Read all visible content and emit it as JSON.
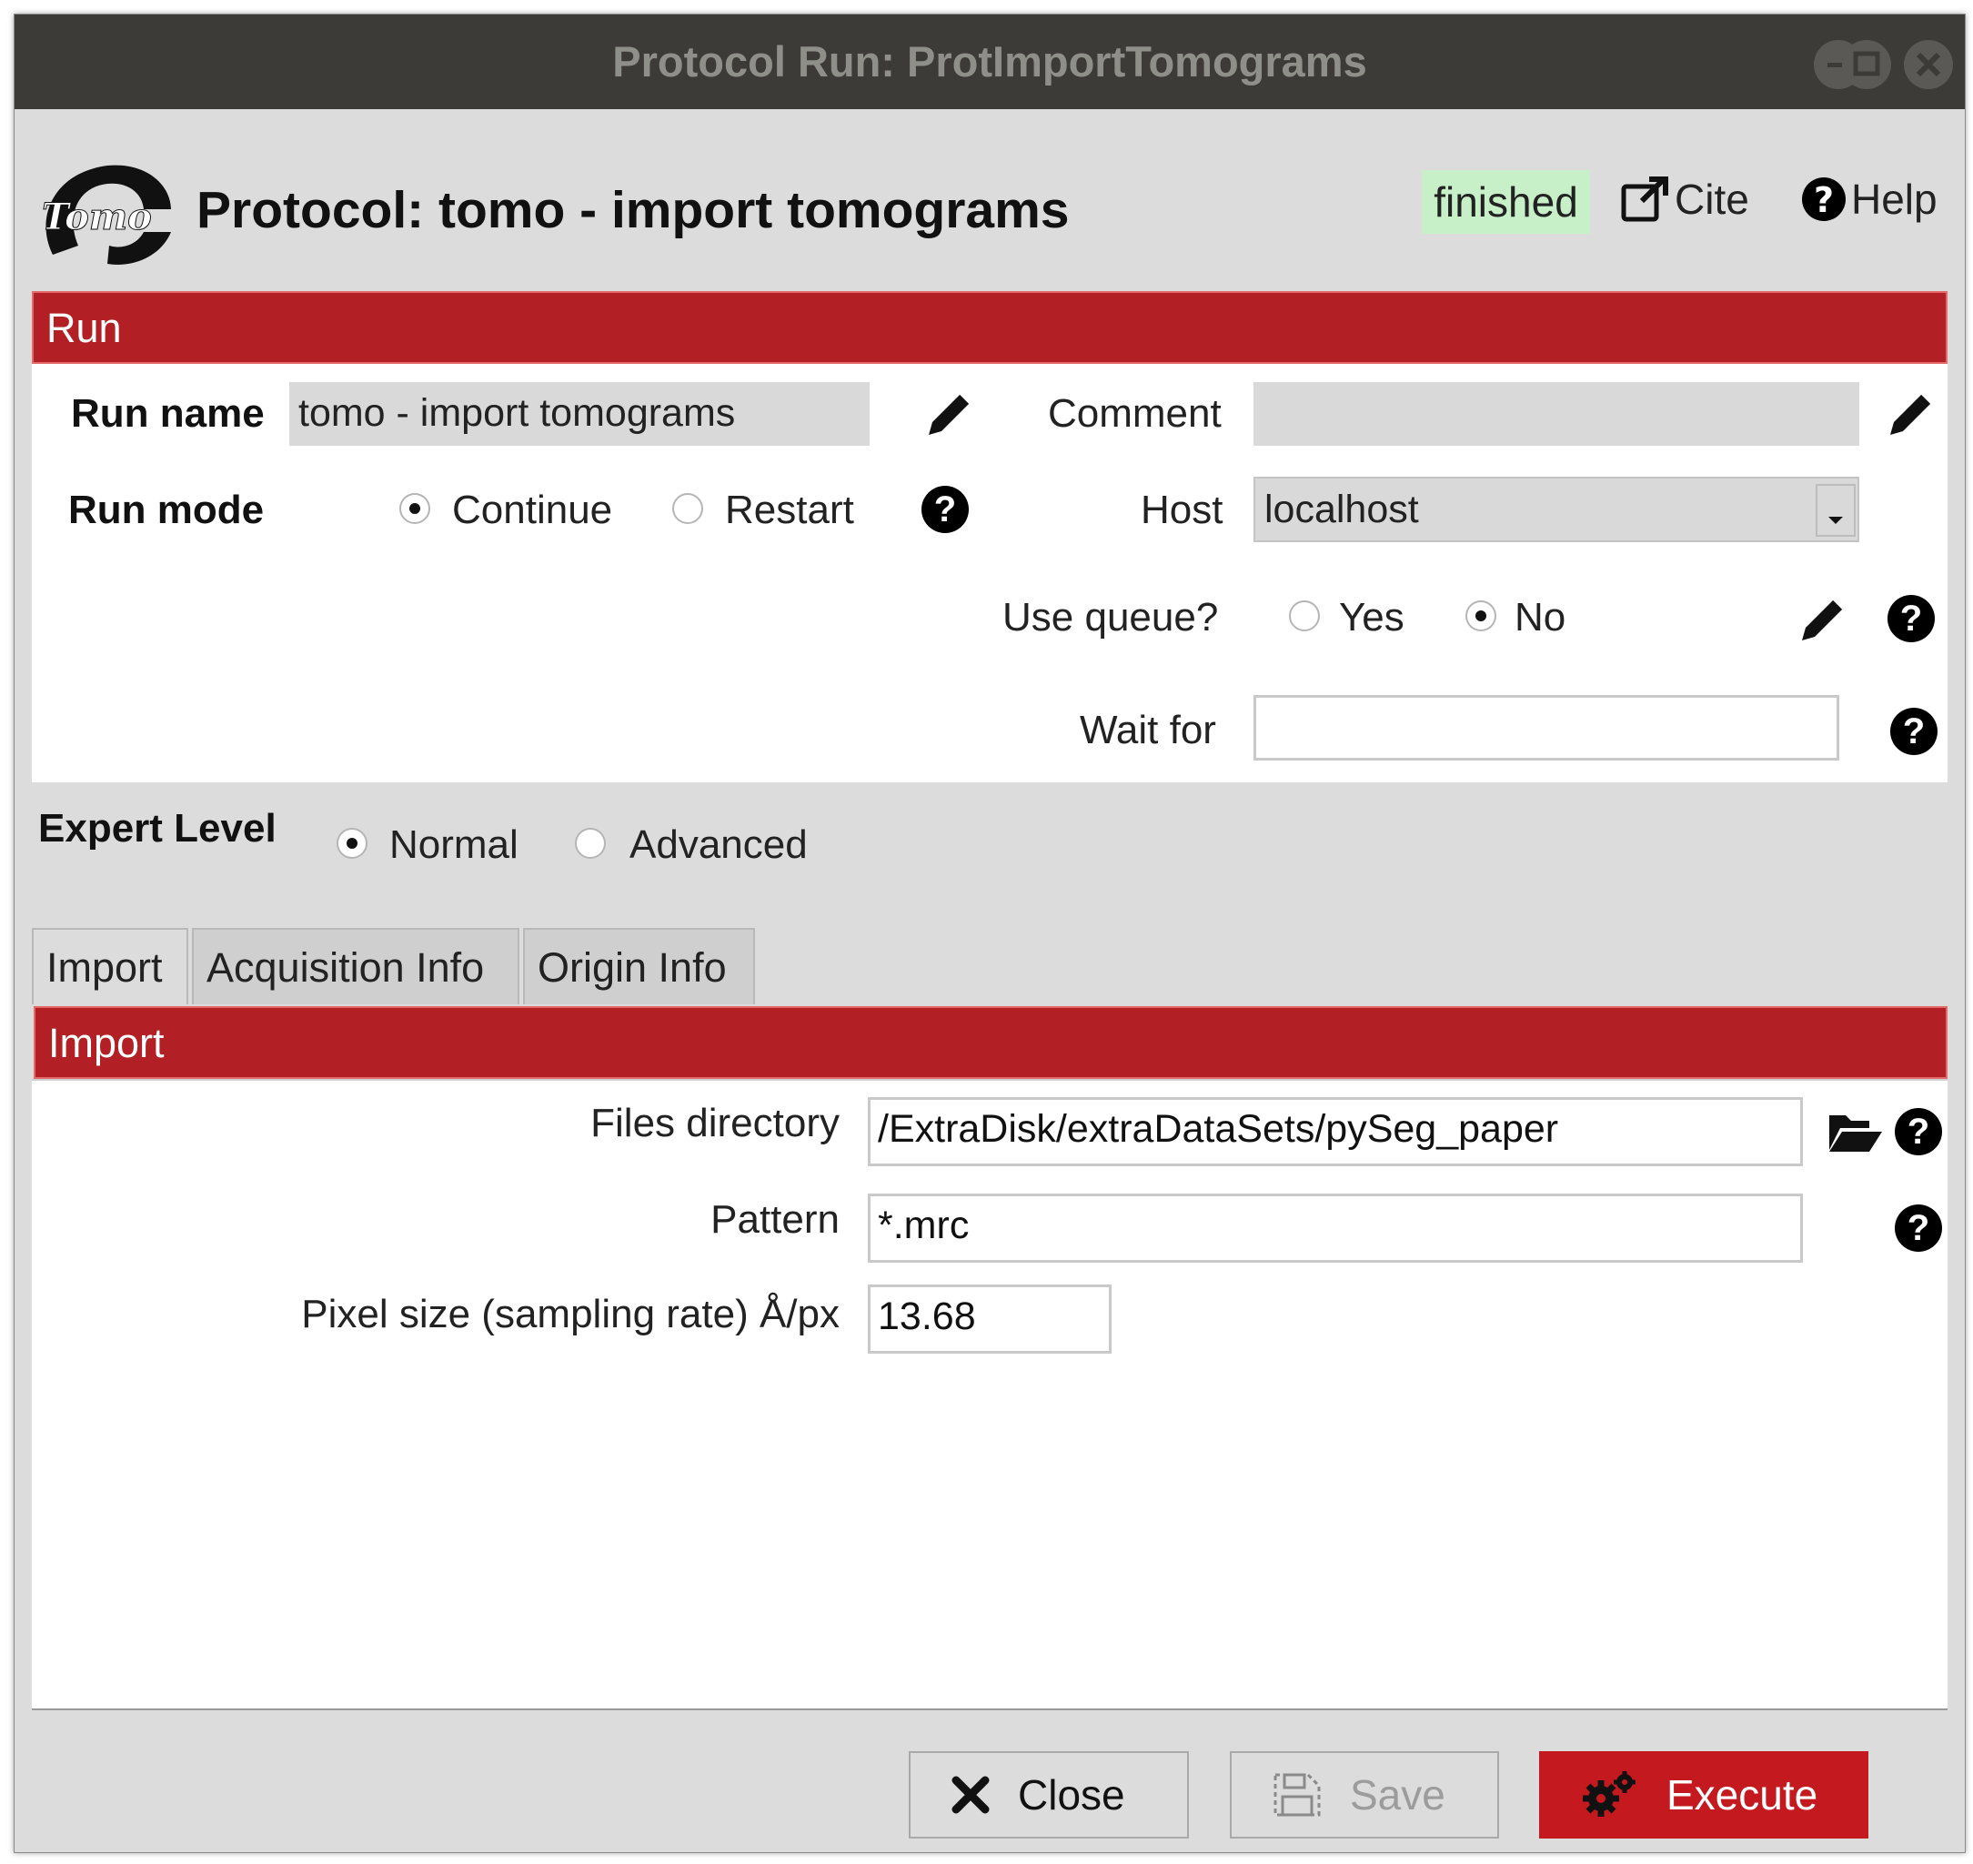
{
  "window": {
    "title": "Protocol Run: ProtImportTomograms"
  },
  "header": {
    "logo_text": "Tomo",
    "protocol_title": "Protocol: tomo - import tomograms",
    "status": "finished",
    "cite_label": "Cite",
    "help_label": "Help"
  },
  "run_section": {
    "title": "Run",
    "run_name_label": "Run name",
    "run_name_value": "tomo - import tomograms",
    "comment_label": "Comment",
    "comment_value": "",
    "run_mode_label": "Run mode",
    "run_mode_options": [
      "Continue",
      "Restart"
    ],
    "run_mode_selected": "Continue",
    "host_label": "Host",
    "host_value": "localhost",
    "use_queue_label": "Use queue?",
    "use_queue_options": [
      "Yes",
      "No"
    ],
    "use_queue_selected": "No",
    "wait_for_label": "Wait for",
    "wait_for_value": ""
  },
  "expert_level": {
    "label": "Expert Level",
    "options": [
      "Normal",
      "Advanced"
    ],
    "selected": "Normal"
  },
  "tabs": [
    {
      "label": "Import",
      "active": true
    },
    {
      "label": "Acquisition Info",
      "active": false
    },
    {
      "label": "Origin Info",
      "active": false
    }
  ],
  "import_section": {
    "title": "Import",
    "files_directory_label": "Files directory",
    "files_directory_value": "/ExtraDisk/extraDataSets/pySeg_paper",
    "pattern_label": "Pattern",
    "pattern_value": "*.mrc",
    "pixel_size_label": "Pixel size (sampling rate) Å/px",
    "pixel_size_value": "13.68"
  },
  "buttons": {
    "close": "Close",
    "save": "Save",
    "execute": "Execute"
  },
  "colors": {
    "section_bar": "#b21f24",
    "execute_button": "#c4191f",
    "status_badge": "#c8f0c8",
    "titlebar": "#3c3b37"
  }
}
